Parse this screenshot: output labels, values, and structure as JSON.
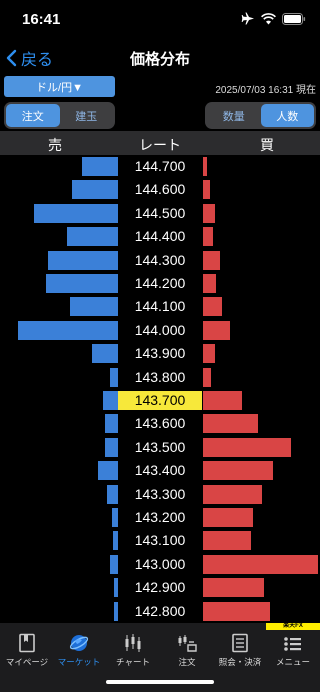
{
  "status": {
    "time": "16:41"
  },
  "nav": {
    "back_label": "戻る",
    "title": "価格分布"
  },
  "pair_selector": {
    "label": "ドル/円▼"
  },
  "timestamp": "2025/07/03 16:31 現在",
  "order_toggle": {
    "items": [
      "注文",
      "建玉"
    ],
    "active": "注文"
  },
  "count_toggle": {
    "items": [
      "数量",
      "人数"
    ],
    "active": "人数"
  },
  "columns": {
    "sell": "売",
    "rate": "レート",
    "buy": "買"
  },
  "chart_data": {
    "type": "bar",
    "current_price": "143.700",
    "rows": [
      {
        "price": "144.700",
        "sell": 36,
        "buy": 4
      },
      {
        "price": "144.600",
        "sell": 46,
        "buy": 7
      },
      {
        "price": "144.500",
        "sell": 84,
        "buy": 12
      },
      {
        "price": "144.400",
        "sell": 51,
        "buy": 10
      },
      {
        "price": "144.300",
        "sell": 70,
        "buy": 17
      },
      {
        "price": "144.200",
        "sell": 72,
        "buy": 13
      },
      {
        "price": "144.100",
        "sell": 48,
        "buy": 19
      },
      {
        "price": "144.000",
        "sell": 100,
        "buy": 27
      },
      {
        "price": "143.900",
        "sell": 26,
        "buy": 12
      },
      {
        "price": "143.800",
        "sell": 8,
        "buy": 8
      },
      {
        "price": "143.700",
        "sell": 15,
        "buy": 39
      },
      {
        "price": "143.600",
        "sell": 13,
        "buy": 55
      },
      {
        "price": "143.500",
        "sell": 13,
        "buy": 88
      },
      {
        "price": "143.400",
        "sell": 20,
        "buy": 70
      },
      {
        "price": "143.300",
        "sell": 11,
        "buy": 59
      },
      {
        "price": "143.200",
        "sell": 6,
        "buy": 50
      },
      {
        "price": "143.100",
        "sell": 5,
        "buy": 48
      },
      {
        "price": "143.000",
        "sell": 8,
        "buy": 115
      },
      {
        "price": "142.900",
        "sell": 4,
        "buy": 61
      },
      {
        "price": "142.800",
        "sell": 4,
        "buy": 67
      }
    ]
  },
  "tabs": [
    {
      "label": "マイページ",
      "icon": "mypage-icon"
    },
    {
      "label": "マーケット",
      "icon": "market-globe-icon"
    },
    {
      "label": "チャート",
      "icon": "candlestick-chart-icon"
    },
    {
      "label": "注文",
      "icon": "order-icon"
    },
    {
      "label": "照会・決済",
      "icon": "inquiry-document-icon"
    },
    {
      "label": "メニュー",
      "icon": "menu-list-icon"
    }
  ],
  "active_tab": "マーケット",
  "brand_tag": "楽天FX",
  "colors": {
    "accent": "#2e8ff0",
    "sell": "#3b80d8",
    "buy": "#d94545",
    "current": "#f7e83a"
  }
}
